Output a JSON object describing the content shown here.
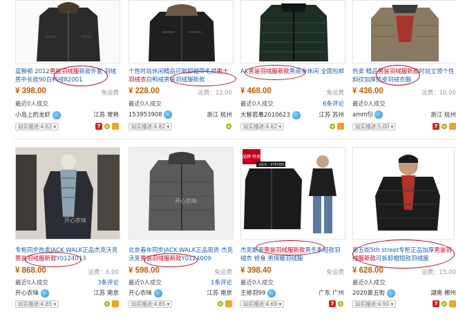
{
  "colors": {
    "title_link": "#1a5fb4",
    "highlight": "#c4001a",
    "price": "#c85a00"
  },
  "products": [
    {
      "title_pre": "蓝狮顿 2012",
      "title_hl": "男装羽绒服",
      "title_post": "新款外套 羽绒男中长款90白鸭绒82001",
      "price": "¥ 398.00",
      "shipping": "免运费",
      "sold": "最近0人成交",
      "reviews": "",
      "seller": "小岛上的龙虾",
      "location": "江苏 常熟",
      "rating": "如实描述:4.62"
    },
    {
      "title_pre": "个性时尚休闲精品可脱卸帽带毛领",
      "title_hl": "男士羽绒衣",
      "title_post": "白鸭绒男装羽绒服新款",
      "price": "¥ 228.00",
      "shipping": "运费：12.00",
      "sold": "最近0人成交",
      "reviews": "",
      "seller": "153953908",
      "location": "浙江 杭州",
      "rating": "如实描述:4.82"
    },
    {
      "title_pre": "AK",
      "title_hl": "男装羽绒服新款",
      "title_post": "男商务休闲 全国包邮",
      "price": "¥ 468.00",
      "shipping": "免运费",
      "sold": "最近0人成交",
      "reviews": "6条评论",
      "seller": "大智若愚2010623",
      "location": "江苏 苏州",
      "rating": "如实描述:4.62"
    },
    {
      "title_pre": "热卖 精品",
      "title_hl": "男装羽绒服新款",
      "title_post": "时尚立领个性斜纹加厚仿皮羽绒衣服",
      "price": "¥ 436.00",
      "shipping": "运费：10.00",
      "sold": "最近0人成交",
      "reviews": "",
      "seller": "ammfjl",
      "location": "浙江 杭州",
      "rating": "如实描述:5.00"
    },
    {
      "title_pre": "专柜同步热卖JACK WALK正品杰克沃克",
      "title_hl": "男装羽绒服新款",
      "title_post": "Y0124013",
      "price": "¥ 868.00",
      "shipping": "运费：6.00",
      "sold": "最近0人成交",
      "reviews": "3条评论",
      "seller": "开心农味",
      "location": "江苏 南京",
      "rating": "如实描述:4.85"
    },
    {
      "title_pre": "北京春年同步JACK WALK正品现货 杰克沃克",
      "title_hl": "男装羽绒服新款",
      "title_post": "Y0124009",
      "price": "¥ 598.00",
      "shipping": "免运费",
      "sold": "最近0人成交",
      "reviews": "1条评论",
      "seller": "开心农味",
      "location": "江苏 南京",
      "rating": "如实描述:4.85"
    },
    {
      "title_pre": "杰克斯蒂",
      "title_hl": "男装羽绒服新款",
      "title_post": "男冬季短款羽绒衣 修身 男保暖羽绒服",
      "price": "¥ 398.40",
      "shipping": "免运费",
      "sold": "最近0人成交",
      "reviews": "",
      "seller": "王修羽99",
      "location": "广东 广州",
      "rating": "如实描述:4.69"
    },
    {
      "title_pre": "第五街5th street专柜正品加厚",
      "title_hl": "男装羽绒服新款",
      "title_post": "可拆卸帽短款羽绒服",
      "price": "¥ 628.00",
      "shipping": "运费：15.00",
      "sold": "最近0人成交",
      "reviews": "",
      "seller": "2020第五街",
      "location": "湖南 郴州",
      "rating": "如实描述:4.90"
    }
  ],
  "image_texts": {
    "watermark": "开心农味",
    "tag_brand": "品牌 特卖",
    "jacket_label": "JACK · STEVEN"
  }
}
